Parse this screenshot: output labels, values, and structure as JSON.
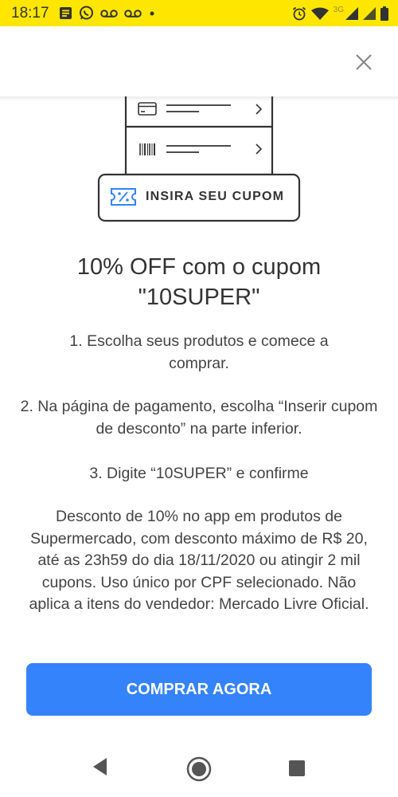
{
  "status_bar": {
    "time": "18:17",
    "network": "3G",
    "background_color": "#ffe600",
    "icons_left": [
      "notification-icon",
      "whatsapp-icon",
      "voicemail-icon",
      "voicemail-icon",
      "dot-icon"
    ],
    "icons_right": [
      "alarm-icon",
      "wifi-icon",
      "signal-icon",
      "signal-icon",
      "battery-icon"
    ]
  },
  "header": {
    "close_icon": "close-icon"
  },
  "illustration": {
    "rows": [
      "card-icon",
      "barcode-icon"
    ],
    "coupon_label": "INSIRA SEU CUPOM",
    "coupon_icon": "coupon-icon"
  },
  "content": {
    "title_line1": "10% OFF com o cupom",
    "title_line2": "\"10SUPER\"",
    "step1": "1. Escolha seus produtos e comece a comprar.",
    "step2": "2. Na página de pagamento, escolha “Inserir cupom de desconto” na parte inferior.",
    "step3": "3. Digite “10SUPER” e confirme",
    "terms": "Desconto de 10% no app em produtos de Supermercado, com desconto máximo de R$ 20, até as 23h59 do dia 18/11/2020 ou atingir 2 mil cupons. Uso único por CPF selecionado. Não aplica a itens do vendedor: Mercado Livre Oficial."
  },
  "cta": {
    "label": "COMPRAR AGORA",
    "color": "#3483fa"
  },
  "nav_bar": {
    "buttons": [
      "back-icon",
      "home-icon",
      "recents-icon"
    ]
  }
}
